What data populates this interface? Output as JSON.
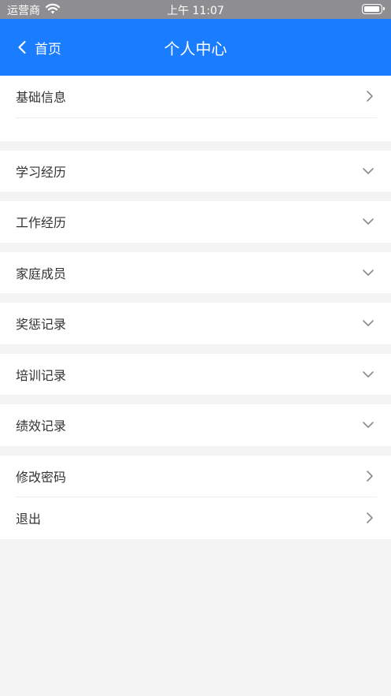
{
  "status_bar": {
    "carrier": "运营商",
    "time": "上午 11:07"
  },
  "nav": {
    "back_label": "首页",
    "title": "个人中心"
  },
  "colors": {
    "nav_bg": "#1a7cff",
    "page_bg": "#f4f4f4"
  },
  "rows": {
    "basic_info": "基础信息",
    "education": "学习经历",
    "work": "工作经历",
    "family": "家庭成员",
    "rewards": "奖惩记录",
    "training": "培训记录",
    "performance": "绩效记录",
    "change_password": "修改密码",
    "logout": "退出"
  },
  "icons": {
    "back": "chevron-left-icon",
    "expand": "chevron-down-icon",
    "navigate": "chevron-right-icon"
  }
}
